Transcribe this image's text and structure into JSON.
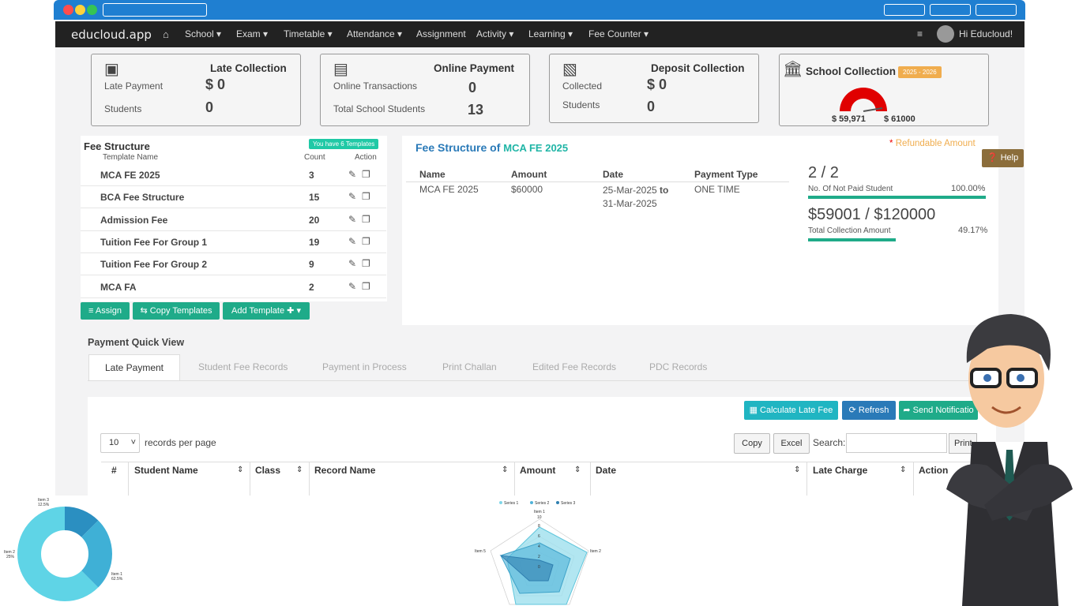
{
  "browser": {
    "title": ""
  },
  "nav": {
    "brand": "educloud.app",
    "items": [
      "School ▾",
      "Exam ▾",
      "Timetable ▾",
      "Attendance ▾",
      "Assignment",
      "Activity ▾",
      "Learning ▾",
      "Fee Counter ▾"
    ],
    "user": "Hi Educloud!"
  },
  "cards": {
    "late": {
      "title": "Late Collection",
      "l1": "Late Payment",
      "v1": "$ 0",
      "l2": "Students",
      "v2": "0"
    },
    "online": {
      "title": "Online Payment",
      "l1": "Online Transactions",
      "v1": "0",
      "l2": "Total School Students",
      "v2": "13"
    },
    "deposit": {
      "title": "Deposit Collection",
      "l1": "Collected",
      "v1": "$ 0",
      "l2": "Students",
      "v2": "0"
    },
    "school": {
      "title": "School Collection",
      "badge": "2025 - 2026",
      "v1": "$ 59,971",
      "v2": "$ 61000",
      "gauge_fraction": 0.98
    }
  },
  "fee_structure": {
    "title": "Fee Structure",
    "badge": "You have 6 Templates",
    "col_name": "Template Name",
    "col_count": "Count",
    "col_action": "Action",
    "rows": [
      {
        "name": "MCA FE 2025",
        "count": "3"
      },
      {
        "name": "BCA Fee Structure",
        "count": "15"
      },
      {
        "name": "Admission Fee",
        "count": "20"
      },
      {
        "name": "Tuition Fee For Group 1",
        "count": "19"
      },
      {
        "name": "Tuition Fee For Group 2",
        "count": "9"
      },
      {
        "name": "MCA FA",
        "count": "2"
      }
    ],
    "assign": "Assign",
    "copy": "Copy Templates",
    "add": "Add Template"
  },
  "detail": {
    "title_prefix": "Fee Structure of",
    "title_name": "MCA FE 2025",
    "refundable": "Refundable Amount",
    "help": "Help",
    "cols": [
      "Name",
      "Amount",
      "Date",
      "Payment Type"
    ],
    "row": {
      "name": "MCA FE 2025",
      "amount": "$60000",
      "date1": "25-Mar-2025",
      "to": "to",
      "date2": "31-Mar-2025",
      "type": "ONE TIME"
    },
    "stat1": {
      "value": "2 / 2",
      "label": "No. Of Not Paid Student",
      "pct": "100.00%",
      "fraction": 1.0
    },
    "stat2": {
      "value": "$59001 / $120000",
      "label": "Total Collection Amount",
      "pct": "49.17%",
      "fraction": 0.4917
    }
  },
  "quickview": {
    "title": "Payment Quick View",
    "tabs": [
      "Late Payment",
      "Student Fee Records",
      "Payment in Process",
      "Print Challan",
      "Edited Fee Records",
      "PDC Records"
    ],
    "calc": "Calculate Late Fee",
    "refresh": "Refresh",
    "send": "Send Notificatio",
    "per_page_val": "10",
    "per_page": "records per page",
    "copy": "Copy",
    "excel": "Excel",
    "search": "Search:",
    "print": "Print",
    "cols": [
      "#",
      "Student Name",
      "Class",
      "Record Name",
      "Amount",
      "Date",
      "Late Charge",
      "Action"
    ]
  },
  "donut": {
    "labels": [
      {
        "t": "Item 3",
        "p": "12.5%"
      },
      {
        "t": "Item 2",
        "p": "25%"
      },
      {
        "t": "Item 1",
        "p": "62.5%"
      }
    ]
  },
  "radar": {
    "legend": [
      "Series 1",
      "Series 2",
      "Series 3"
    ],
    "axes": [
      "Item 1",
      "Item 2",
      "Item 5"
    ],
    "ticks": [
      "10",
      "8",
      "6",
      "4",
      "2",
      "0"
    ]
  },
  "colors": {
    "teal": "#1fab89",
    "navy": "#222222",
    "accent": "#1f7fd1",
    "red": "#e00000",
    "orange": "#f0ad4e"
  }
}
